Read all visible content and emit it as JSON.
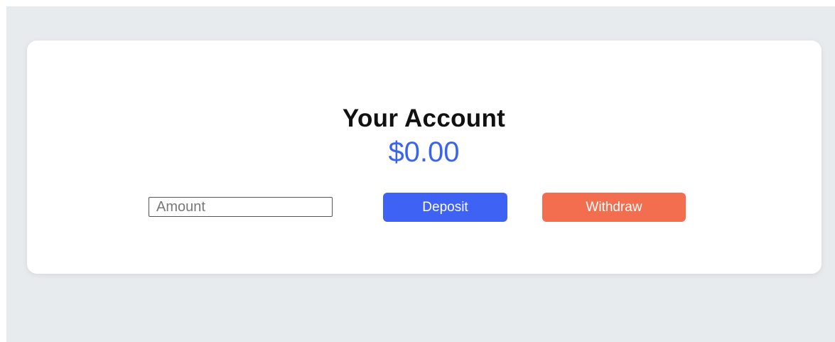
{
  "account": {
    "title": "Your Account",
    "balance": "$0.00"
  },
  "form": {
    "amount_placeholder": "Amount",
    "amount_value": ""
  },
  "actions": {
    "deposit_label": "Deposit",
    "withdraw_label": "Withdraw"
  },
  "colors": {
    "page_background": "#e8ebee",
    "card_background": "#ffffff",
    "balance_text": "#3a63f0",
    "deposit_button": "#3e62f4",
    "withdraw_button": "#f36d4f"
  }
}
